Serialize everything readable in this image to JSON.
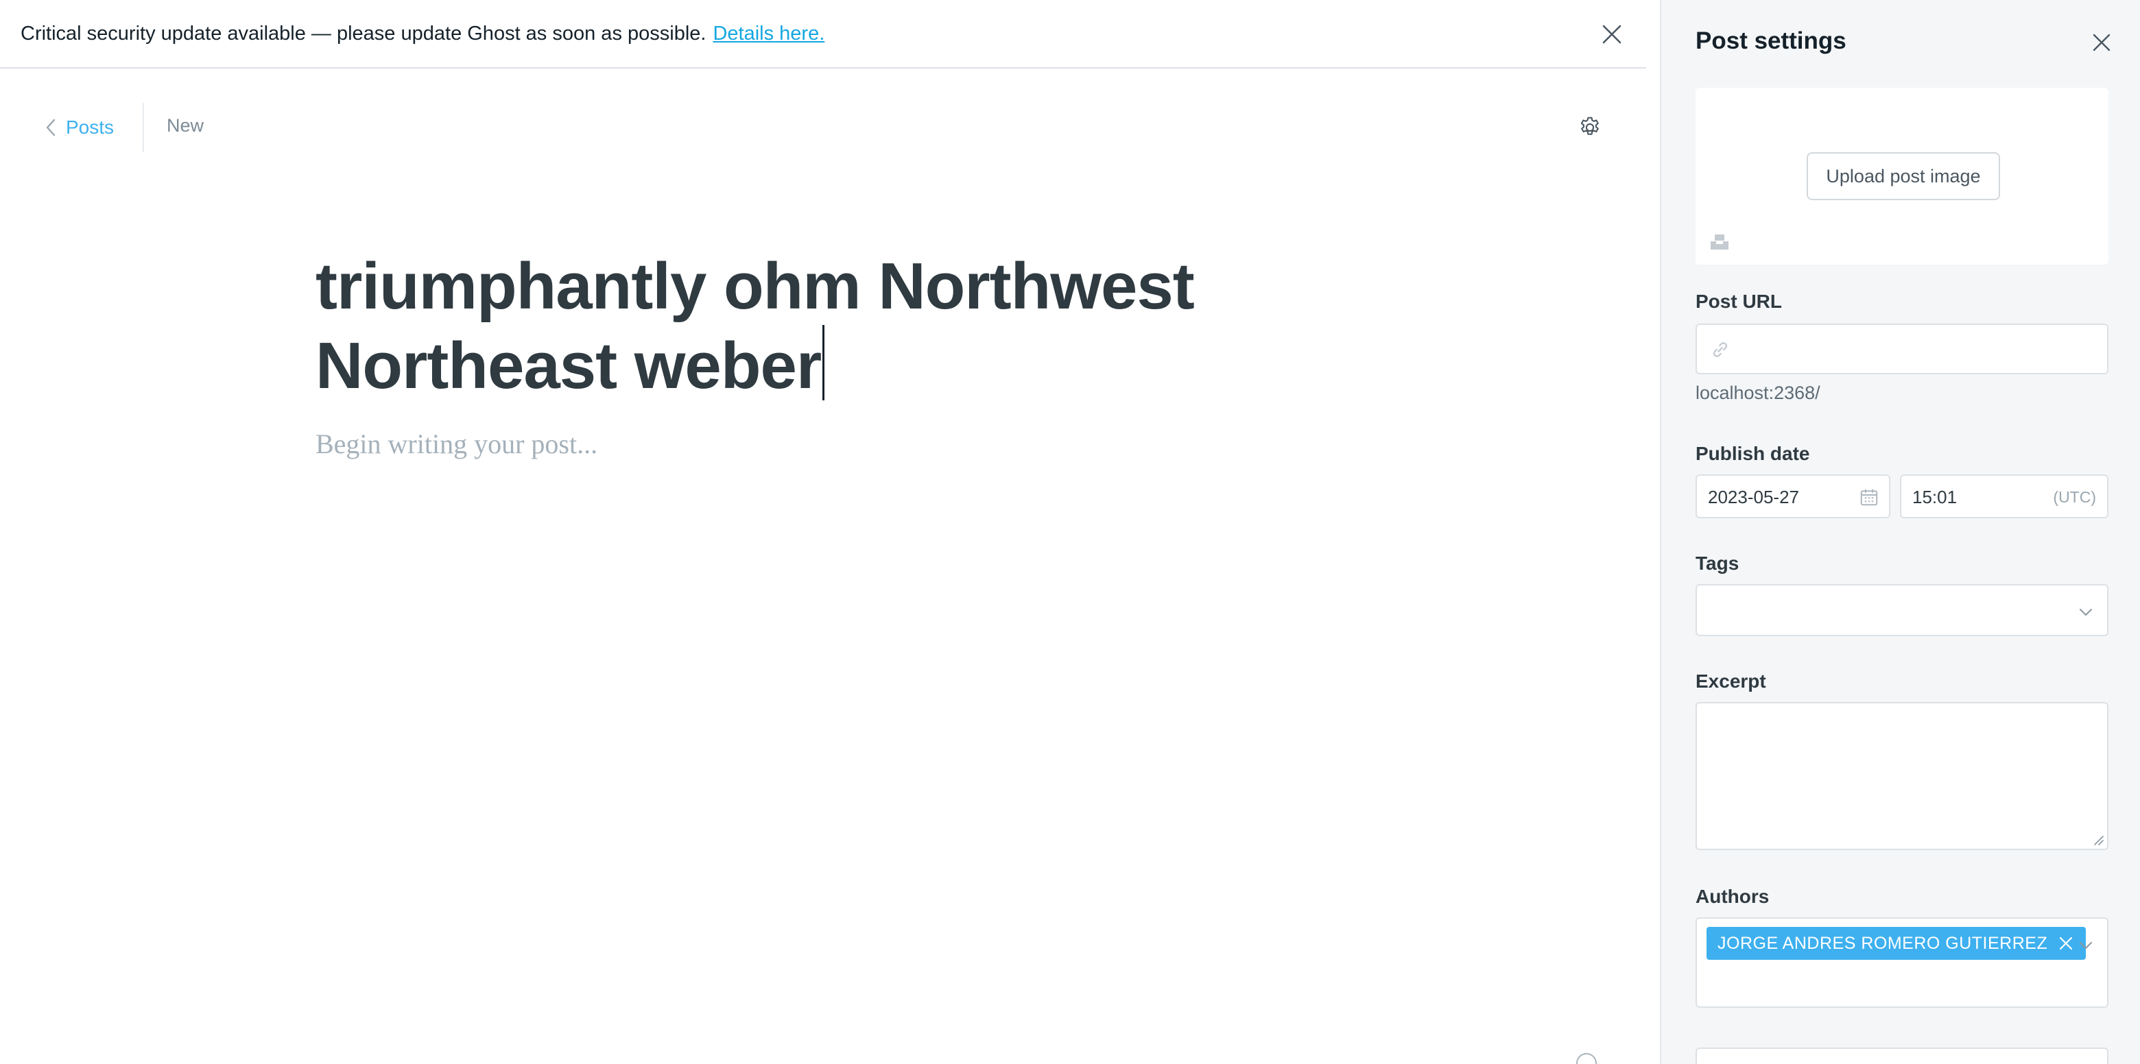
{
  "banner": {
    "message": "Critical security update available — please update Ghost as soon as possible.",
    "link_label": "Details here."
  },
  "nav": {
    "back_label": "Posts",
    "status": "New"
  },
  "post": {
    "title": "triumphantly ohm Northwest Northeast weber",
    "body_placeholder": "Begin writing your post..."
  },
  "settings": {
    "heading": "Post settings",
    "upload_label": "Upload post image",
    "url_label": "Post URL",
    "url_value": "",
    "url_preview": "localhost:2368/",
    "publish_label": "Publish date",
    "publish_date": "2023-05-27",
    "publish_time": "15:01",
    "timezone": "(UTC)",
    "tags_label": "Tags",
    "excerpt_label": "Excerpt",
    "excerpt_value": "",
    "authors_label": "Authors",
    "authors": [
      "JORGE ANDRES ROMERO GUTIERREZ"
    ]
  },
  "colors": {
    "accent": "#3eb0ef",
    "link": "#14a7e0",
    "title_text": "#2f3a41",
    "sidebar_bg": "#f4f6f8"
  },
  "icons": {
    "banner_close": "close-icon",
    "back": "chevron-left-icon",
    "settings": "gear-icon",
    "unsplash": "unsplash-icon",
    "url": "link-icon",
    "calendar": "calendar-icon",
    "tags_dropdown": "chevron-down-icon",
    "chip_remove": "close-icon"
  }
}
